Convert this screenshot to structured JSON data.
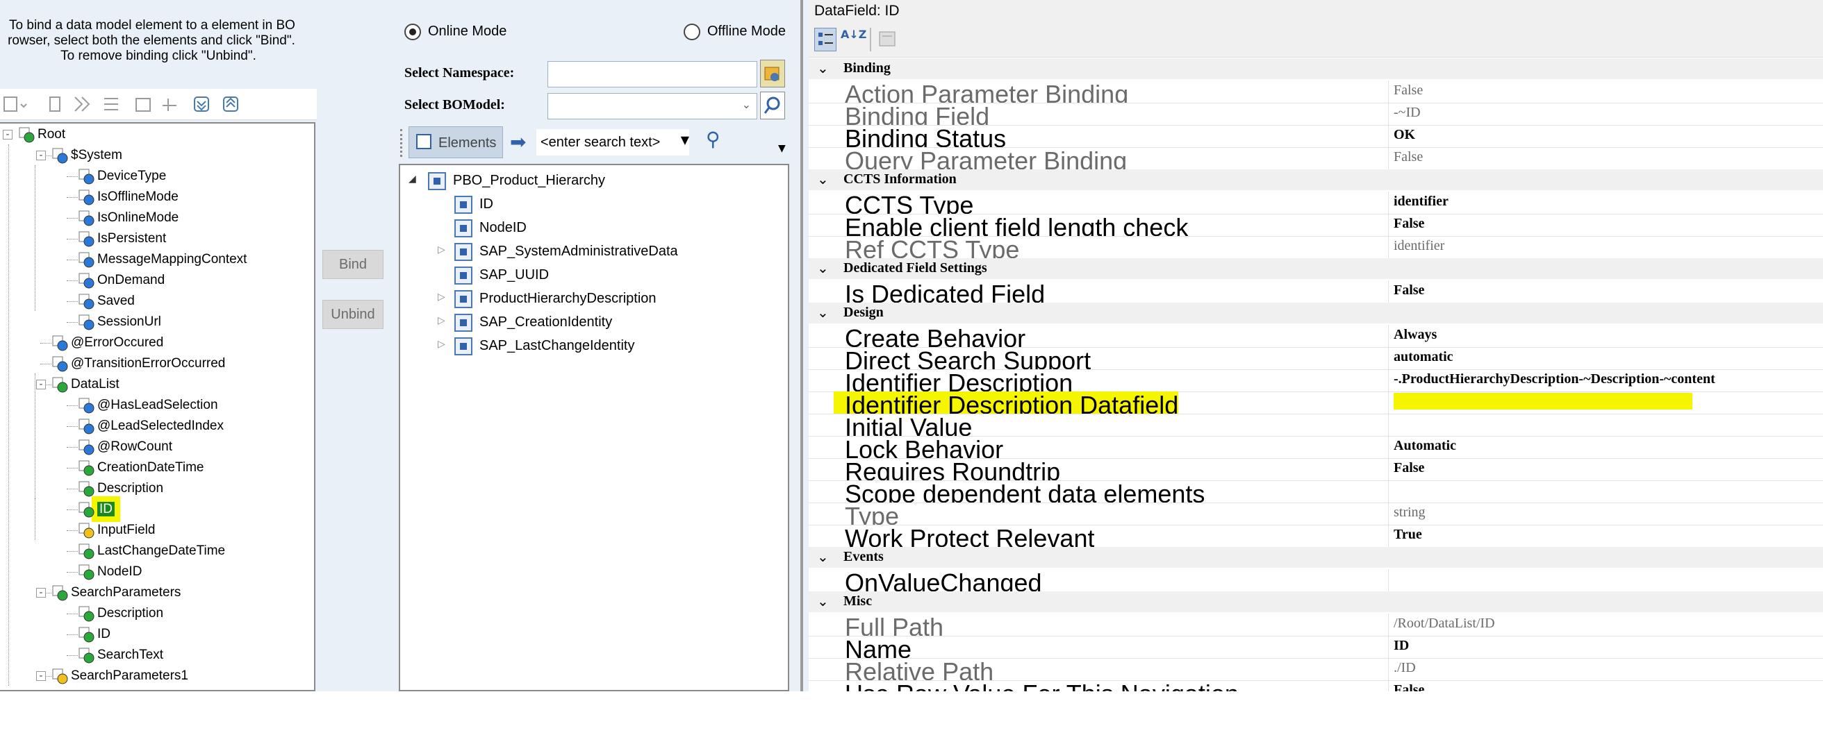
{
  "left": {
    "instructions": [
      "To bind a data model element to a element in BO",
      "rowser, select both the elements and click \"Bind\".",
      "To remove binding click \"Unbind\"."
    ],
    "tree": [
      {
        "label": "Root",
        "depth": 0,
        "icon": "root-icon"
      },
      {
        "label": "$System",
        "depth": 1,
        "icon": "folder-icon"
      },
      {
        "label": "DeviceType",
        "depth": 2,
        "icon": "field-icon-blue"
      },
      {
        "label": "IsOfflineMode",
        "depth": 2,
        "icon": "field-icon-blue"
      },
      {
        "label": "IsOnlineMode",
        "depth": 2,
        "icon": "field-icon-blue"
      },
      {
        "label": "IsPersistent",
        "depth": 2,
        "icon": "field-icon-blue"
      },
      {
        "label": "MessageMappingContext",
        "depth": 2,
        "icon": "field-icon-blue"
      },
      {
        "label": "OnDemand",
        "depth": 2,
        "icon": "field-icon-blue"
      },
      {
        "label": "Saved",
        "depth": 2,
        "icon": "field-icon-blue"
      },
      {
        "label": "SessionUrl",
        "depth": 2,
        "icon": "field-icon-blue"
      },
      {
        "label": "@ErrorOccured",
        "depth": 1,
        "icon": "field-icon-blue"
      },
      {
        "label": "@TransitionErrorOccurred",
        "depth": 1,
        "icon": "field-icon-blue"
      },
      {
        "label": "DataList",
        "depth": 1,
        "icon": "list-icon"
      },
      {
        "label": "@HasLeadSelection",
        "depth": 2,
        "icon": "field-icon-blue"
      },
      {
        "label": "@LeadSelectedIndex",
        "depth": 2,
        "icon": "field-icon-blue"
      },
      {
        "label": "@RowCount",
        "depth": 2,
        "icon": "field-icon-blue"
      },
      {
        "label": "CreationDateTime",
        "depth": 2,
        "icon": "field-icon-green"
      },
      {
        "label": "Description",
        "depth": 2,
        "icon": "field-icon-green"
      },
      {
        "label": "ID",
        "depth": 2,
        "icon": "field-icon-green",
        "selected": true
      },
      {
        "label": "InputField",
        "depth": 2,
        "icon": "field-icon-yellow"
      },
      {
        "label": "LastChangeDateTime",
        "depth": 2,
        "icon": "field-icon-green"
      },
      {
        "label": "NodeID",
        "depth": 2,
        "icon": "field-icon-green"
      },
      {
        "label": "SearchParameters",
        "depth": 1,
        "icon": "folder-icon-green"
      },
      {
        "label": "Description",
        "depth": 2,
        "icon": "field-icon-green"
      },
      {
        "label": "ID",
        "depth": 2,
        "icon": "field-icon-green"
      },
      {
        "label": "SearchText",
        "depth": 2,
        "icon": "field-icon-green"
      },
      {
        "label": "SearchParameters1",
        "depth": 1,
        "icon": "folder-icon-yellow"
      }
    ]
  },
  "middle": {
    "online_mode": "Online Mode",
    "offline_mode": "Offline Mode",
    "namespace_label": "Select Namespace:",
    "bomodel_label": "Select BOModel:",
    "elements_label": "Elements",
    "search_placeholder": "<enter search text>",
    "bind": "Bind",
    "unbind": "Unbind",
    "bo_tree": [
      {
        "label": "PBO_Product_Hierarchy",
        "depth": 0,
        "expander": "expanded"
      },
      {
        "label": "ID",
        "depth": 1,
        "expander": ""
      },
      {
        "label": "NodeID",
        "depth": 1,
        "expander": ""
      },
      {
        "label": "SAP_SystemAdministrativeData",
        "depth": 1,
        "expander": "collapsed"
      },
      {
        "label": "SAP_UUID",
        "depth": 1,
        "expander": ""
      },
      {
        "label": "ProductHierarchyDescription",
        "depth": 1,
        "expander": "collapsed"
      },
      {
        "label": "SAP_CreationIdentity",
        "depth": 1,
        "expander": "collapsed"
      },
      {
        "label": "SAP_LastChangeIdentity",
        "depth": 1,
        "expander": "collapsed"
      }
    ]
  },
  "props": {
    "title": "DataField: ID",
    "sections": [
      {
        "title": "Binding",
        "rows": [
          {
            "name": "Action Parameter Binding",
            "value": "False",
            "gray": true
          },
          {
            "name": "Binding Field",
            "value": "-~ID",
            "gray": true
          },
          {
            "name": "Binding Status",
            "value": "OK",
            "gray": false
          },
          {
            "name": "Query Parameter Binding",
            "value": "False",
            "gray": true
          }
        ]
      },
      {
        "title": "CCTS Information",
        "rows": [
          {
            "name": "CCTS Type",
            "value": "identifier",
            "gray": false
          },
          {
            "name": "Enable client field length check",
            "value": "False",
            "gray": false
          },
          {
            "name": "Ref CCTS Type",
            "value": "identifier",
            "gray": true
          }
        ]
      },
      {
        "title": "Dedicated Field Settings",
        "rows": [
          {
            "name": "Is Dedicated Field",
            "value": "False",
            "gray": false
          }
        ]
      },
      {
        "title": "Design",
        "rows": [
          {
            "name": "Create Behavior",
            "value": "Always",
            "gray": false
          },
          {
            "name": "Direct Search Support",
            "value": "automatic",
            "gray": false
          },
          {
            "name": "Identifier Description",
            "value": "-.ProductHierarchyDescription-~Description-~content",
            "gray": false
          },
          {
            "name": "Identifier Description Datafield",
            "value": "",
            "gray": false,
            "highlight": true
          },
          {
            "name": "Initial Value",
            "value": "",
            "gray": false
          },
          {
            "name": "Lock Behavior",
            "value": "Automatic",
            "gray": false
          },
          {
            "name": "Requires Roundtrip",
            "value": "False",
            "gray": false
          },
          {
            "name": "Scope dependent data elements",
            "value": "",
            "gray": false
          },
          {
            "name": "Type",
            "value": "string",
            "gray": true
          },
          {
            "name": "Work Protect Relevant",
            "value": "True",
            "gray": false
          }
        ]
      },
      {
        "title": "Events",
        "rows": [
          {
            "name": "OnValueChanged",
            "value": "",
            "gray": false
          }
        ]
      },
      {
        "title": "Misc",
        "rows": [
          {
            "name": "Full Path",
            "value": "/Root/DataList/ID",
            "gray": true
          },
          {
            "name": "Name",
            "value": "ID",
            "gray": false
          },
          {
            "name": "Relative Path",
            "value": "./ID",
            "gray": true
          },
          {
            "name": "Use Raw Value For This Navigation",
            "value": "False",
            "gray": false
          }
        ]
      }
    ]
  },
  "colors": {
    "highlight": "#f5f500",
    "selected_node": "#1a8a1a",
    "pane_bg": "#eaf0f7"
  }
}
